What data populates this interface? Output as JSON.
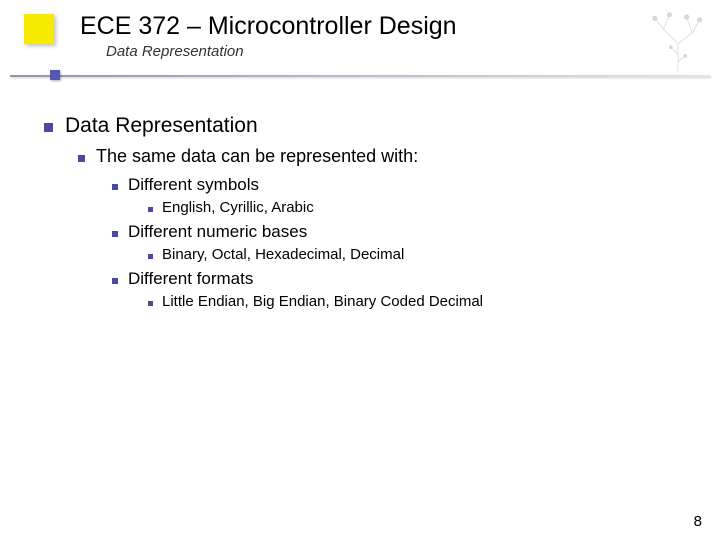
{
  "header": {
    "title": "ECE 372 – Microcontroller Design",
    "subtitle": "Data Representation"
  },
  "content": {
    "l1": "Data Representation",
    "l2": "The same data can be represented with:",
    "items": [
      {
        "label": "Different symbols",
        "sub": "English, Cyrillic, Arabic"
      },
      {
        "label": "Different numeric bases",
        "sub": "Binary, Octal, Hexadecimal, Decimal"
      },
      {
        "label": "Different formats",
        "sub": "Little Endian, Big Endian, Binary Coded Decimal"
      }
    ]
  },
  "page_number": "8"
}
